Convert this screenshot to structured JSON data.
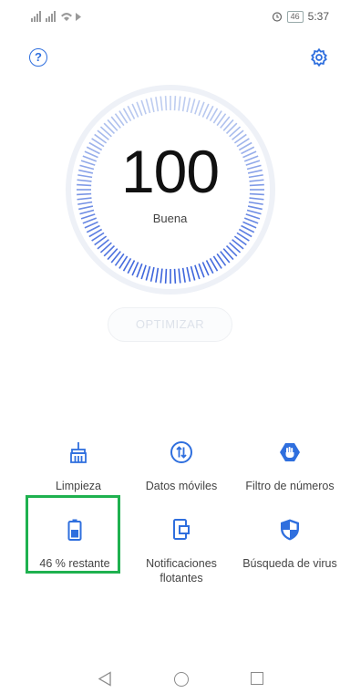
{
  "status_bar": {
    "left_icons": "📶 📶 wifi cast",
    "battery_level": "46",
    "time": "5:37",
    "alarm_icon": "alarm-clock-icon"
  },
  "header": {
    "help_label": "?",
    "settings_icon": "gear-icon",
    "accent_color": "#2f6fde"
  },
  "score": {
    "value": "100",
    "status": "Buena"
  },
  "actions": {
    "optimize_label": "OPTIMIZAR"
  },
  "tiles": [
    {
      "icon": "broom-icon",
      "label": "Limpieza"
    },
    {
      "icon": "mobile-data-icon",
      "label": "Datos móviles"
    },
    {
      "icon": "hand-shield-icon",
      "label": "Filtro de números"
    },
    {
      "icon": "battery-icon",
      "label": "46 % restante"
    },
    {
      "icon": "floating-notifications-icon",
      "label": "Notificaciones flotantes"
    },
    {
      "icon": "virus-shield-icon",
      "label": "Búsqueda de virus"
    }
  ],
  "highlight_color": "#1fb14f"
}
